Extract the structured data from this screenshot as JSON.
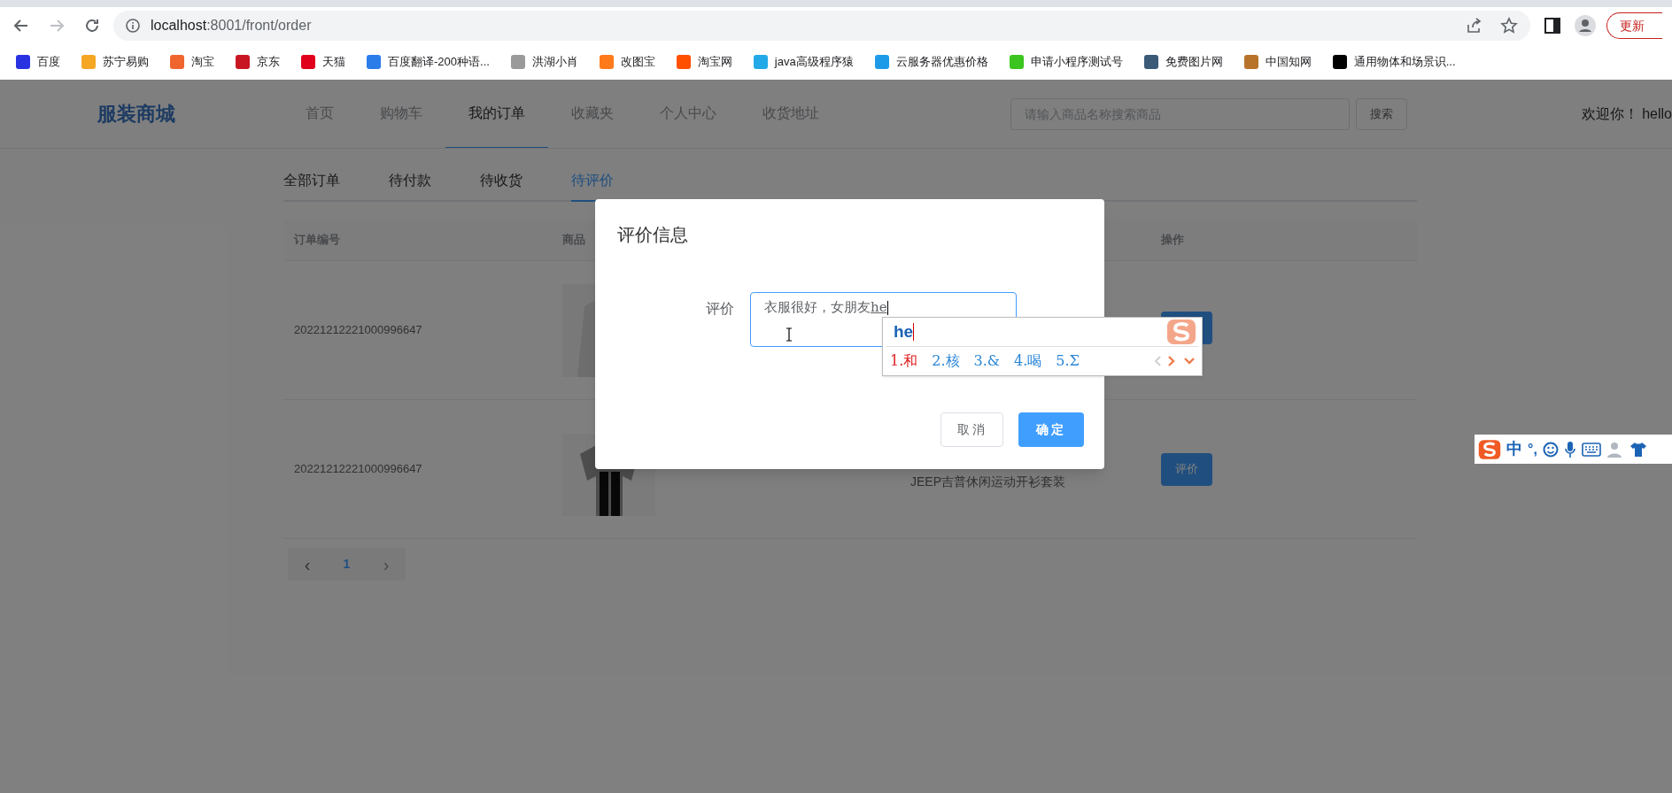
{
  "browser": {
    "address": {
      "host": "localhost",
      "path": ":8001/front/order"
    },
    "update_button": "更新",
    "bookmarks": [
      {
        "label": "百度",
        "color": "#2932e1"
      },
      {
        "label": "苏宁易购",
        "color": "#f5a623"
      },
      {
        "label": "淘宝",
        "color": "#f0642d"
      },
      {
        "label": "京东",
        "color": "#c91623"
      },
      {
        "label": "天猫",
        "color": "#e0001b"
      },
      {
        "label": "百度翻译-200种语...",
        "color": "#2b7de9"
      },
      {
        "label": "洪湖小肖",
        "color": "#9a9a9a"
      },
      {
        "label": "改图宝",
        "color": "#ff7a1a"
      },
      {
        "label": "淘宝网",
        "color": "#ff5000"
      },
      {
        "label": "java高级程序猿",
        "color": "#23a9e8"
      },
      {
        "label": "云服务器优惠价格",
        "color": "#1d9be8"
      },
      {
        "label": "申请小程序测试号",
        "color": "#3cc51f"
      },
      {
        "label": "免费图片网",
        "color": "#3a5a78"
      },
      {
        "label": "中国知网",
        "color": "#b8732a"
      },
      {
        "label": "通用物体和场景识...",
        "color": "#000000"
      }
    ]
  },
  "site": {
    "logo": "服装商城",
    "nav": [
      {
        "label": "首页",
        "selected": false
      },
      {
        "label": "购物车",
        "selected": false
      },
      {
        "label": "我的订单",
        "selected": true
      },
      {
        "label": "收藏夹",
        "selected": false
      },
      {
        "label": "个人中心",
        "selected": false
      },
      {
        "label": "收货地址",
        "selected": false
      }
    ],
    "search": {
      "placeholder": "请输入商品名称搜索商品",
      "button": "搜索"
    },
    "welcome": "欢迎你！ hello"
  },
  "order_tabs": [
    {
      "label": "全部订单",
      "selected": false
    },
    {
      "label": "待付款",
      "selected": false
    },
    {
      "label": "待收货",
      "selected": false
    },
    {
      "label": "待评价",
      "selected": true
    }
  ],
  "table": {
    "columns": [
      "订单编号",
      "商品",
      "操作"
    ],
    "rows": [
      {
        "order_no": "20221212221000996647"
      },
      {
        "order_no": "20221212221000996647",
        "name": "JEEP吉普休闲运动开衫套装",
        "action": "评价"
      }
    ]
  },
  "pagination": {
    "prev": "‹",
    "next": "›",
    "pages": [
      {
        "label": "1",
        "selected": true
      }
    ]
  },
  "dialog": {
    "title": "评价信息",
    "field_label": "评价",
    "textarea": {
      "value": "衣服很好，女朋友",
      "composing": "he"
    },
    "buttons": [
      {
        "label": "取消",
        "kind": "default"
      },
      {
        "label": "确定",
        "kind": "primary"
      }
    ]
  },
  "ime_popup": {
    "input": "he",
    "candidates": [
      {
        "label": "1.和",
        "selected": true
      },
      {
        "label": "2.核",
        "selected": false
      },
      {
        "label": "3.&",
        "selected": false
      },
      {
        "label": "4.喝",
        "selected": false
      },
      {
        "label": "5.Σ",
        "selected": false
      }
    ]
  },
  "ime_toolbar": {
    "mode": "中",
    "punctuation": "°,"
  }
}
